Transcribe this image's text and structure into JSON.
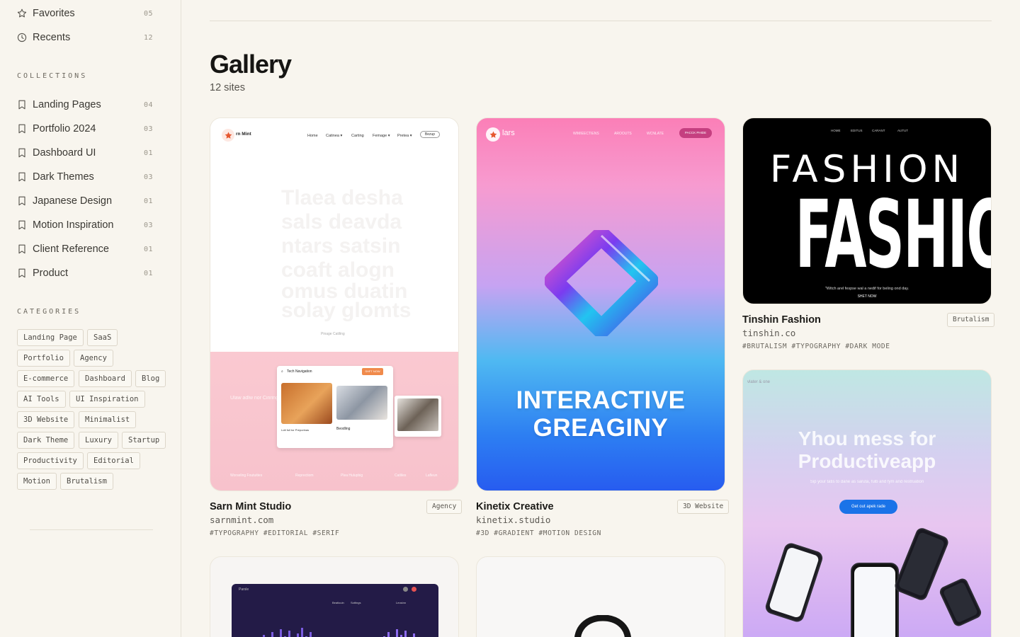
{
  "sidebar": {
    "favorites": {
      "label": "Favorites",
      "count": "05"
    },
    "recents": {
      "label": "Recents",
      "count": "12"
    },
    "collections_title": "COLLECTIONS",
    "collections": [
      {
        "label": "Landing Pages",
        "count": "04"
      },
      {
        "label": "Portfolio 2024",
        "count": "03"
      },
      {
        "label": "Dashboard UI",
        "count": "01"
      },
      {
        "label": "Dark Themes",
        "count": "03"
      },
      {
        "label": "Japanese Design",
        "count": "01"
      },
      {
        "label": "Motion Inspiration",
        "count": "03"
      },
      {
        "label": "Client Reference",
        "count": "01"
      },
      {
        "label": "Product",
        "count": "01"
      }
    ],
    "categories_title": "CATEGORIES",
    "categories": [
      "Landing Page",
      "SaaS",
      "Portfolio",
      "Agency",
      "E-commerce",
      "Dashboard",
      "Blog",
      "AI Tools",
      "UI Inspiration",
      "3D Website",
      "Minimalist",
      "Dark Theme",
      "Luxury",
      "Startup",
      "Productivity",
      "Editorial",
      "Motion",
      "Brutalism"
    ]
  },
  "main": {
    "title": "Gallery",
    "subtitle": "12 sites",
    "cards": [
      {
        "title": "Sarn Mint Studio",
        "url": "sarnmint.com",
        "tags": "#TYPOGRAPHY  #EDITORIAL  #SERIF",
        "badge": "Agency",
        "preview": {
          "brand": "rn Mint",
          "nav": [
            "Home",
            "Catinea ▾",
            "Carting",
            "Femage ▾",
            "Pretea ▾"
          ],
          "nav_button": "Bezup",
          "ghost_lines": [
            "Tlaea desha",
            "sals deavda",
            "ntars satsin",
            "coaft alogn",
            "omus duatin",
            "solay glomts"
          ],
          "caption": "Pinage Catiling",
          "shot_label": "Tech Navigation",
          "shot_button": "SHFT NOW",
          "shot_caption_1": "Lott fuil tor Preporinas",
          "shot_caption_2": "Beodling",
          "pink_text": "Ulaw adlw nor Cinrings...",
          "footer_items": [
            "Worseling Foutuities",
            "Reprectiom",
            "Plea Hulupbig",
            "Catliles",
            "Lafleun"
          ]
        }
      },
      {
        "title": "Kinetix Creative",
        "url": "kinetix.studio",
        "tags": "#3D  #GRADIENT  #MOTION DESIGN",
        "badge": "3D Website",
        "preview": {
          "brand": "lars",
          "nav": [
            "WIMIEECTIENS",
            "AROOUTS",
            "WCNLATE"
          ],
          "nav_button": "PACCK PHIDE",
          "headline_1": "INTERACTIVE",
          "headline_2": "GREAGINY"
        }
      },
      {
        "title": "Tinshin Fashion",
        "url": "tinshin.co",
        "tags": "#BRUTALISM  #TYPOGRAPHY  #DARK MODE",
        "badge": "Brutalism",
        "preview": {
          "nav": [
            "HOME",
            "EDITUS",
            "CARANT",
            "AUTUT"
          ],
          "top_word": "FASHION",
          "big_word": "FASHION",
          "tagline": "\"Witch arel fespse wal a nedif for beling ond day.",
          "cta": "SHET NOW"
        }
      },
      {
        "title": "",
        "url": "",
        "tags": "",
        "badge": "",
        "preview": {
          "brand": "vlater & one",
          "headline_1": "Yhou mess for",
          "headline_2": "Productiveapp",
          "subtext": "Sip your tatis to dane as saruta, fulb and fym and restruation",
          "cta": "Get out apek rade"
        }
      },
      {
        "title": "",
        "url": "",
        "tags": "",
        "badge": "",
        "preview": {
          "app_name": "Parsle",
          "stat_1": "Beatlouin",
          "stat_2": "Sottings",
          "stat_3": "Leosinn"
        }
      },
      {
        "title": "",
        "url": "",
        "tags": "",
        "badge": "",
        "preview": {}
      }
    ]
  }
}
